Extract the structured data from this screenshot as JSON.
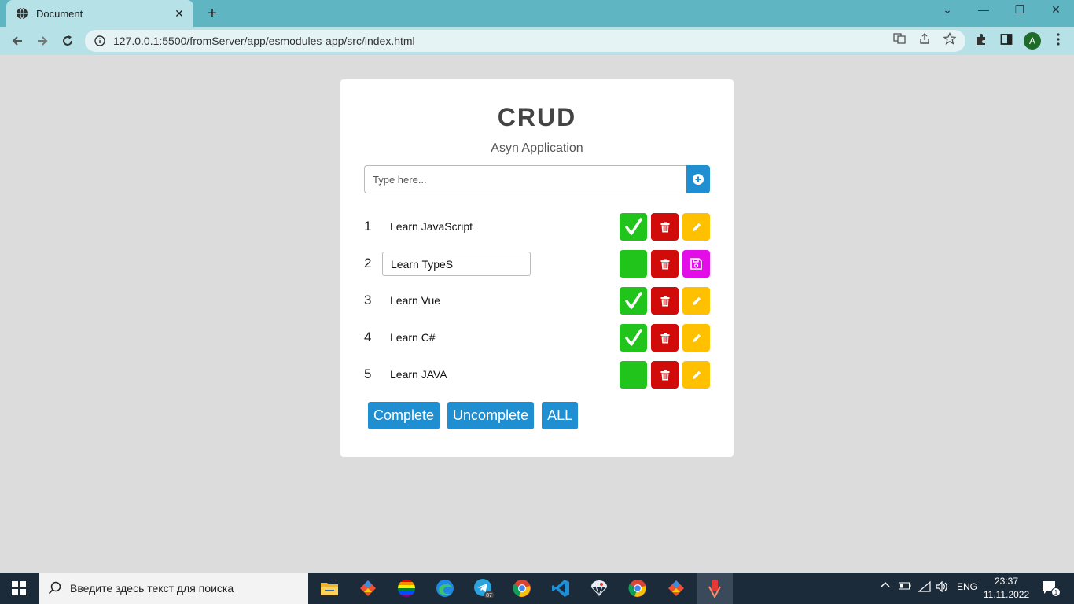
{
  "browser": {
    "tab_title": "Document",
    "url": "127.0.0.1:5500/fromServer/app/esmodules-app/src/index.html",
    "profile_initial": "A"
  },
  "app": {
    "title": "CRUD",
    "subtitle": "Asyn Application",
    "input_placeholder": "Type here...",
    "todos": [
      {
        "num": "1",
        "text": "Learn JavaScript",
        "completed": true,
        "editing": false
      },
      {
        "num": "2",
        "text": "Learn TypeS",
        "completed": false,
        "editing": true
      },
      {
        "num": "3",
        "text": "Learn Vue",
        "completed": true,
        "editing": false
      },
      {
        "num": "4",
        "text": "Learn C#",
        "completed": true,
        "editing": false
      },
      {
        "num": "5",
        "text": "Learn JAVA",
        "completed": false,
        "editing": false
      }
    ],
    "filters": [
      "Complete",
      "Uncomplete",
      "ALL"
    ]
  },
  "colors": {
    "complete_button": "#21c41b",
    "delete_button": "#d10a0a",
    "edit_button": "#ffc000",
    "save_button": "#e20de7",
    "primary": "#1f8fd1"
  },
  "taskbar": {
    "search_placeholder": "Введите здесь текст для поиска",
    "language": "ENG",
    "time": "23:37",
    "date": "11.11.2022",
    "notification_count": "1",
    "telegram_badge": "87"
  }
}
